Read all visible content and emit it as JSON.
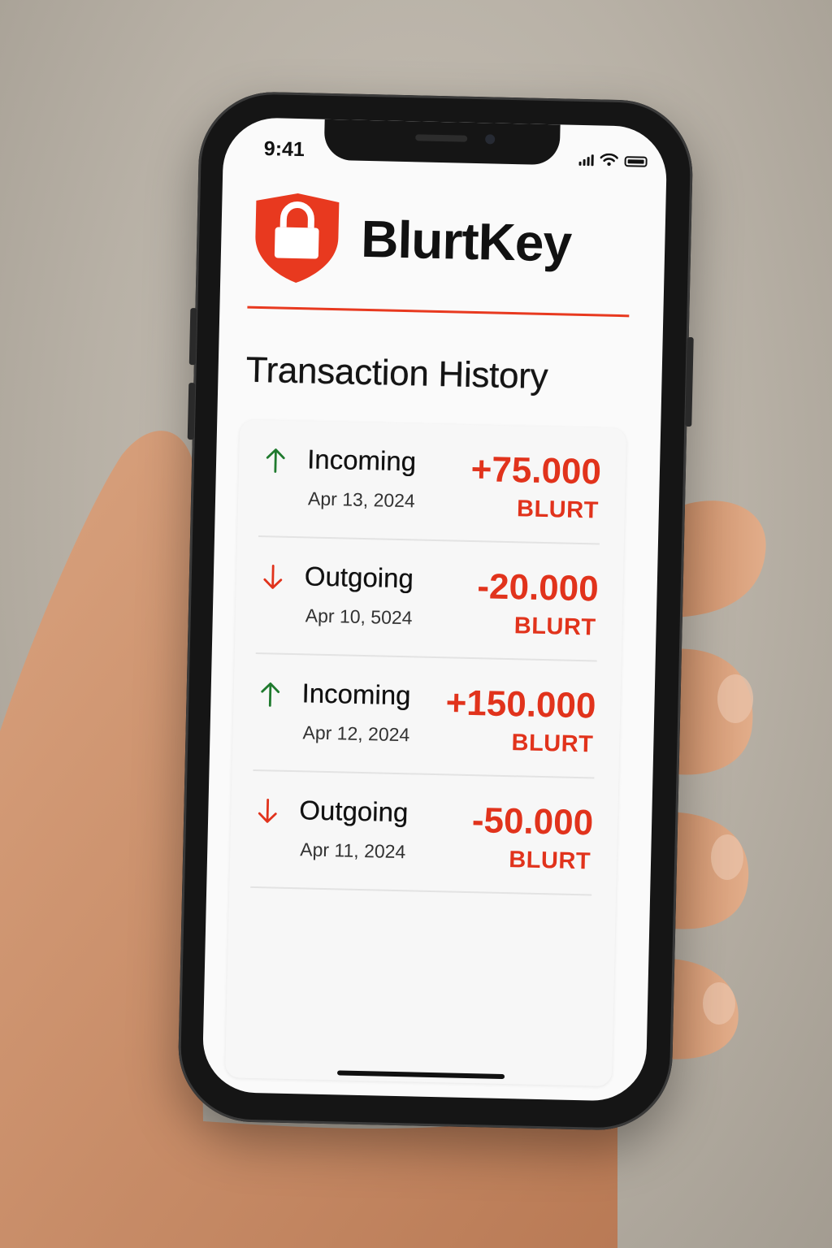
{
  "status_bar": {
    "time": "9:41"
  },
  "app": {
    "name": "BlurtKey",
    "logo_icon": "shield-lock-icon",
    "brand_color": "#e8391f"
  },
  "page": {
    "title": "Transaction History"
  },
  "transactions": [
    {
      "direction": "up",
      "type": "Incoming",
      "date": "Apr 13, 2024",
      "amount": "+75.000",
      "unit": "BLURT"
    },
    {
      "direction": "down",
      "type": "Outgoing",
      "date": "Apr 10, 5024",
      "amount": "-20.000",
      "unit": "BLURT"
    },
    {
      "direction": "up",
      "type": "Incoming",
      "date": "Apr 12, 2024",
      "amount": "+150.000",
      "unit": "BLURT"
    },
    {
      "direction": "down",
      "type": "Outgoing",
      "date": "Apr 11, 2024",
      "amount": "-50.000",
      "unit": "BLURT"
    }
  ],
  "colors": {
    "incoming_arrow": "#1f7a2e",
    "outgoing_arrow": "#e1331c",
    "amount": "#e1331c"
  }
}
